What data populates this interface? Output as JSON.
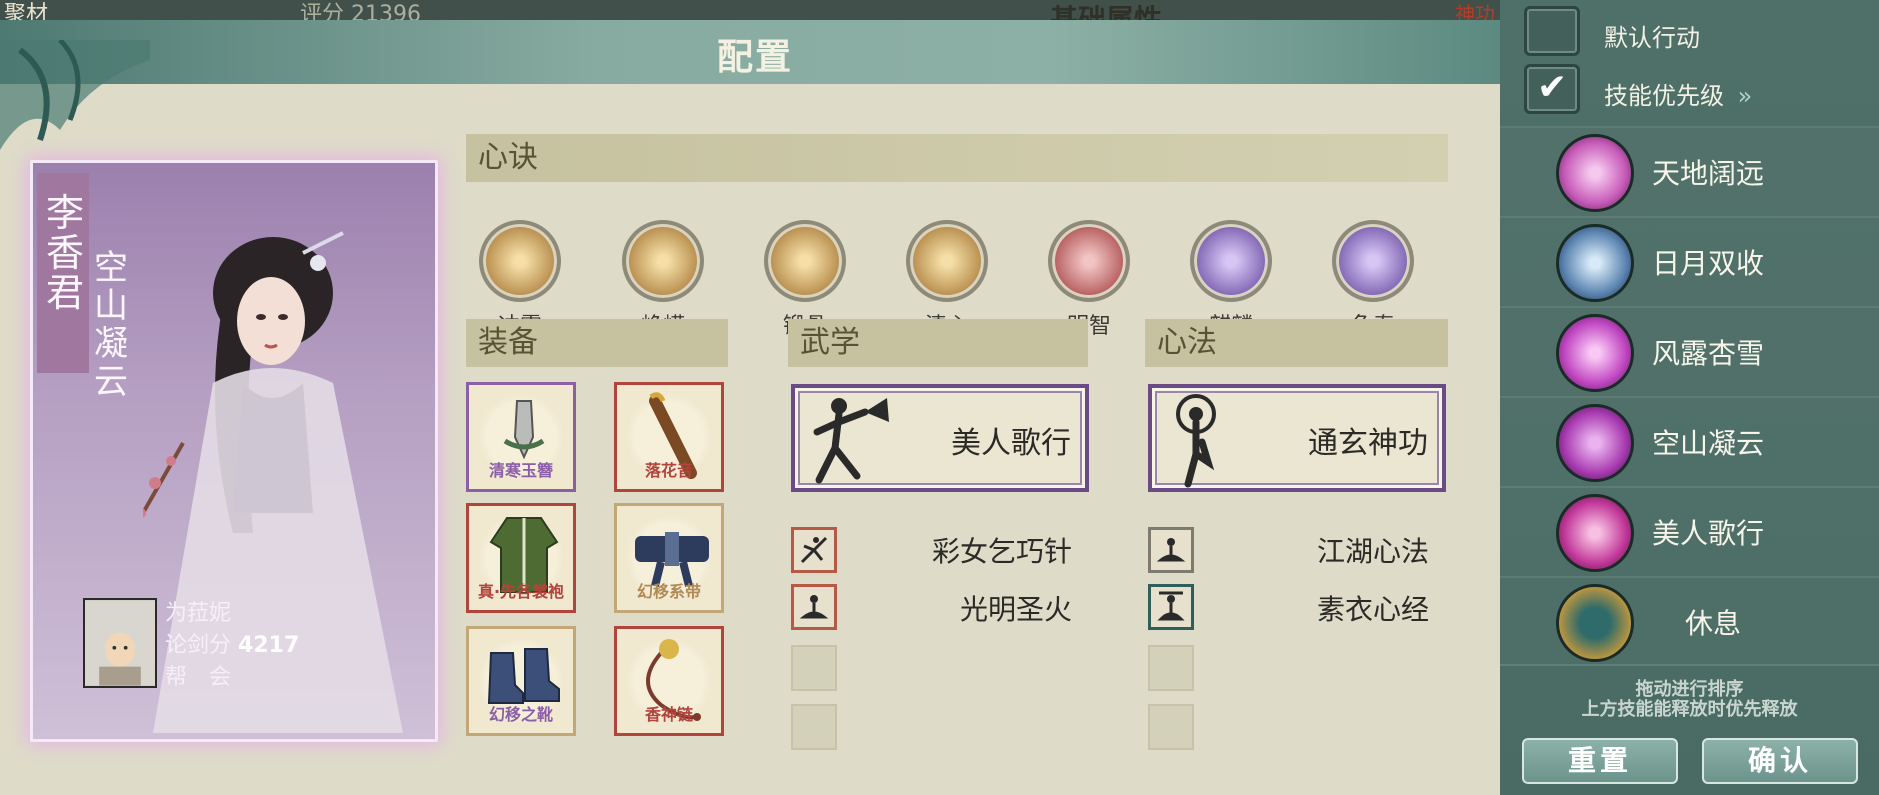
{
  "background": {
    "left_text": "聚材",
    "score_text": "评分 21396",
    "basic_attr": "基础属性",
    "right_text": "神功"
  },
  "panel": {
    "title": "配置"
  },
  "character": {
    "name": "李香君",
    "title": "空山凝云",
    "player": {
      "name": "为菈妮",
      "score_label": "论剑分",
      "score_value": "4217",
      "guild_label": "帮　会"
    }
  },
  "xinjue": {
    "header": "心诀",
    "items": [
      {
        "label": "冲霄",
        "color": "#b58a4a"
      },
      {
        "label": "峥嵘",
        "color": "#b58a4a"
      },
      {
        "label": "锻骨",
        "color": "#b58a4a"
      },
      {
        "label": "清心",
        "color": "#b58a4a"
      },
      {
        "label": "明智",
        "color": "#b45a5a"
      },
      {
        "label": "麒麟",
        "color": "#7e62b1"
      },
      {
        "label": "龟寿",
        "color": "#7e62b1"
      }
    ]
  },
  "equipment": {
    "header": "装备",
    "items": [
      {
        "name": "清寒玉簪",
        "color": "#8b5fa8",
        "icon": "hairpin-icon"
      },
      {
        "name": "落花音",
        "color": "#b2443c",
        "icon": "flute-icon"
      },
      {
        "name": "真·先各裳袍",
        "color": "#b2443c",
        "icon": "robe-icon"
      },
      {
        "name": "幻移系带",
        "color": "#b08a55",
        "icon": "belt-icon"
      },
      {
        "name": "幻移之靴",
        "color": "#8b5fa8",
        "icon": "boots-icon"
      },
      {
        "name": "香神链",
        "color": "#b2443c",
        "icon": "necklace-icon"
      }
    ]
  },
  "martial": {
    "header": "武学",
    "main": "美人歌行",
    "subs": [
      "彩女乞巧针",
      "光明圣火"
    ]
  },
  "heart_method": {
    "header": "心法",
    "main": "通玄神功",
    "subs": [
      "江湖心法",
      "素衣心经"
    ]
  },
  "sidebar": {
    "default_action": "默认行动",
    "skill_priority": "技能优先级",
    "priority_arrow": "»",
    "skills": [
      {
        "name": "天地阔远",
        "color": "#c75ab8"
      },
      {
        "name": "日月双收",
        "color": "#5d86b3"
      },
      {
        "name": "风露杏雪",
        "color": "#c147c2"
      },
      {
        "name": "空山凝云",
        "color": "#a83ab0"
      },
      {
        "name": "美人歌行",
        "color": "#c2389a"
      },
      {
        "name": "休息",
        "color": "#c89a3c"
      }
    ],
    "note_line1": "拖动进行排序",
    "note_line2": "上方技能能释放时优先释放",
    "reset": "重置",
    "confirm": "确认"
  }
}
